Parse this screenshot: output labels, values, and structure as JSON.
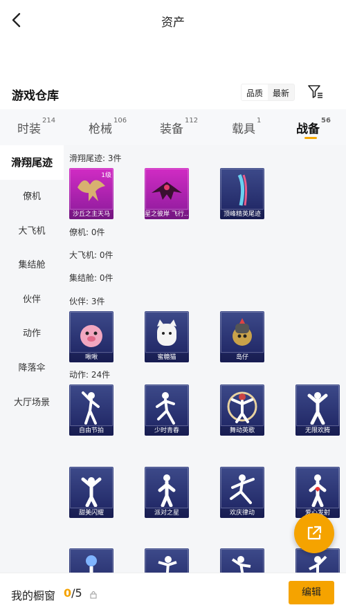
{
  "header": {
    "title": "资产"
  },
  "warehouse": {
    "title": "游戏仓库",
    "sort_options": [
      "品质",
      "最新"
    ],
    "selected_sort": "品质"
  },
  "categories": [
    {
      "label": "时装",
      "count": "214"
    },
    {
      "label": "枪械",
      "count": "106"
    },
    {
      "label": "装备",
      "count": "112"
    },
    {
      "label": "载具",
      "count": "1"
    },
    {
      "label": "战备",
      "count": "56",
      "active": true
    }
  ],
  "sidebar": {
    "items": [
      {
        "label": "滑翔尾迹",
        "active": true
      },
      {
        "label": "僚机"
      },
      {
        "label": "大飞机"
      },
      {
        "label": "集结舱"
      },
      {
        "label": "伙伴"
      },
      {
        "label": "动作"
      },
      {
        "label": "降落伞"
      },
      {
        "label": "大厅场景"
      }
    ]
  },
  "groups": {
    "glide": {
      "header": "滑翔尾迹: 3件",
      "items": [
        {
          "name": "沙丘之主天马",
          "level": "1级",
          "style": "purple"
        },
        {
          "name": "星之彼岸 飞行…",
          "style": "purple"
        },
        {
          "name": "顶峰精英尾迹",
          "style": "blue"
        }
      ]
    },
    "wingman": {
      "header": "僚机: 0件"
    },
    "plane": {
      "header": "大飞机: 0件"
    },
    "pod": {
      "header": "集结舱: 0件"
    },
    "partner": {
      "header": "伙伴: 3件",
      "items": [
        {
          "name": "啾啾",
          "style": "blue"
        },
        {
          "name": "蜜糖猫",
          "style": "blue"
        },
        {
          "name": "岛仔",
          "style": "blue"
        }
      ]
    },
    "emote": {
      "header": "动作: 24件",
      "items": [
        {
          "name": "自由节拍"
        },
        {
          "name": "少时青春"
        },
        {
          "name": "舞动英歌"
        },
        {
          "name": "无限欢腾"
        },
        {
          "name": "甜美闪耀"
        },
        {
          "name": "派对之星"
        },
        {
          "name": "欢庆律动"
        },
        {
          "name": "爱心发射"
        },
        {
          "name": ""
        },
        {
          "name": ""
        },
        {
          "name": ""
        },
        {
          "name": ""
        }
      ]
    }
  },
  "footer": {
    "label": "我的橱窗",
    "current": "0",
    "total": "/5",
    "edit_label": "编辑"
  },
  "colors": {
    "accent": "#f5a300",
    "purple_card": "#c52ab8",
    "blue_card": "#2a3377"
  }
}
